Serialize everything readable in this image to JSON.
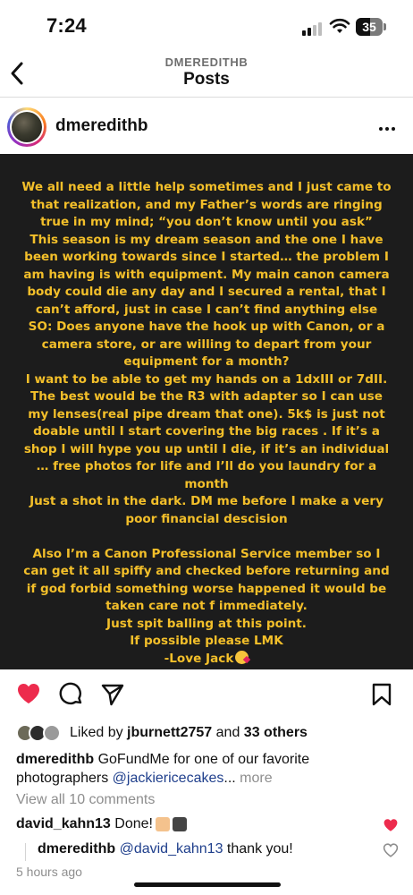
{
  "status_bar": {
    "time": "7:24",
    "battery_level": "35",
    "icons": [
      "signal-icon",
      "wifi-icon",
      "battery-icon"
    ]
  },
  "nav": {
    "account": "DMEREDITHB",
    "title": "Posts",
    "back_icon": "chevron-left-icon"
  },
  "post": {
    "username": "dmeredithb",
    "more_icon": "more-horizontal-icon",
    "image_text_lines": [
      "We all need a little help sometimes and I just came to",
      "that realization, and my Father’s words are ringing",
      "true in my mind; “you don’t know until you ask”",
      "This season is my dream season and the one I have",
      "been working towards since I started… the problem I",
      "am having is with equipment. My main canon camera",
      "body could die any day and I secured a rental, that I",
      "can’t afford,  just in case I can’t find anything else",
      "SO: Does anyone have the hook up with Canon, or a",
      "camera store, or are willing to depart from your",
      "equipment for a month?",
      "I want to be able to get my hands on a 1dxIII or 7dII.",
      "The best would be the R3 with adapter so I can use",
      "my lenses(real pipe dream that one). 5k$ is just not",
      "doable until I start covering the big races . If it’s a",
      "shop I will hype you up until I die, if it’s an individual",
      "… free photos for life and I’ll do you laundry for a",
      "month",
      "Just a shot in the dark. DM me before I make a very",
      "poor financial descision",
      "",
      "Also I’m a Canon Professional Service member so I",
      "can get it all spiffy and checked before returning and",
      "if god forbid something worse happened it would be",
      "taken care not f immediately.",
      "Just spit balling at this point.",
      "If possible please LMK",
      "-Love Jack"
    ],
    "actions": {
      "like_icon": "heart-filled-icon",
      "comment_icon": "comment-icon",
      "share_icon": "send-icon",
      "save_icon": "bookmark-icon",
      "like_color": "#ED2B4D"
    },
    "likes": {
      "prefix": "Liked by",
      "user": "jburnett2757",
      "conjunction": "and",
      "others": "33 others"
    },
    "caption": {
      "username": "dmeredithb",
      "text": "GoFundMe for one of our favorite photographers",
      "mention": "@jackiericecakes",
      "ellipsis": "...",
      "more_label": "more"
    },
    "view_comments": "View all 10 comments",
    "comments": [
      {
        "username": "david_kahn13",
        "text": "Done!",
        "emojis": [
          "raised-hands-emoji",
          "camera-emoji"
        ],
        "liked": true
      }
    ],
    "reply": {
      "username": "dmeredithb",
      "mention": "@david_kahn13",
      "text": "thank you!",
      "liked": false
    },
    "timestamp": "5 hours ago"
  },
  "colors": {
    "accent_text": "#F3BF2A",
    "image_bg": "#1C1C1C",
    "link": "#1F3F8C",
    "muted": "#8E8E8E",
    "heart_red": "#ED2B4D"
  }
}
